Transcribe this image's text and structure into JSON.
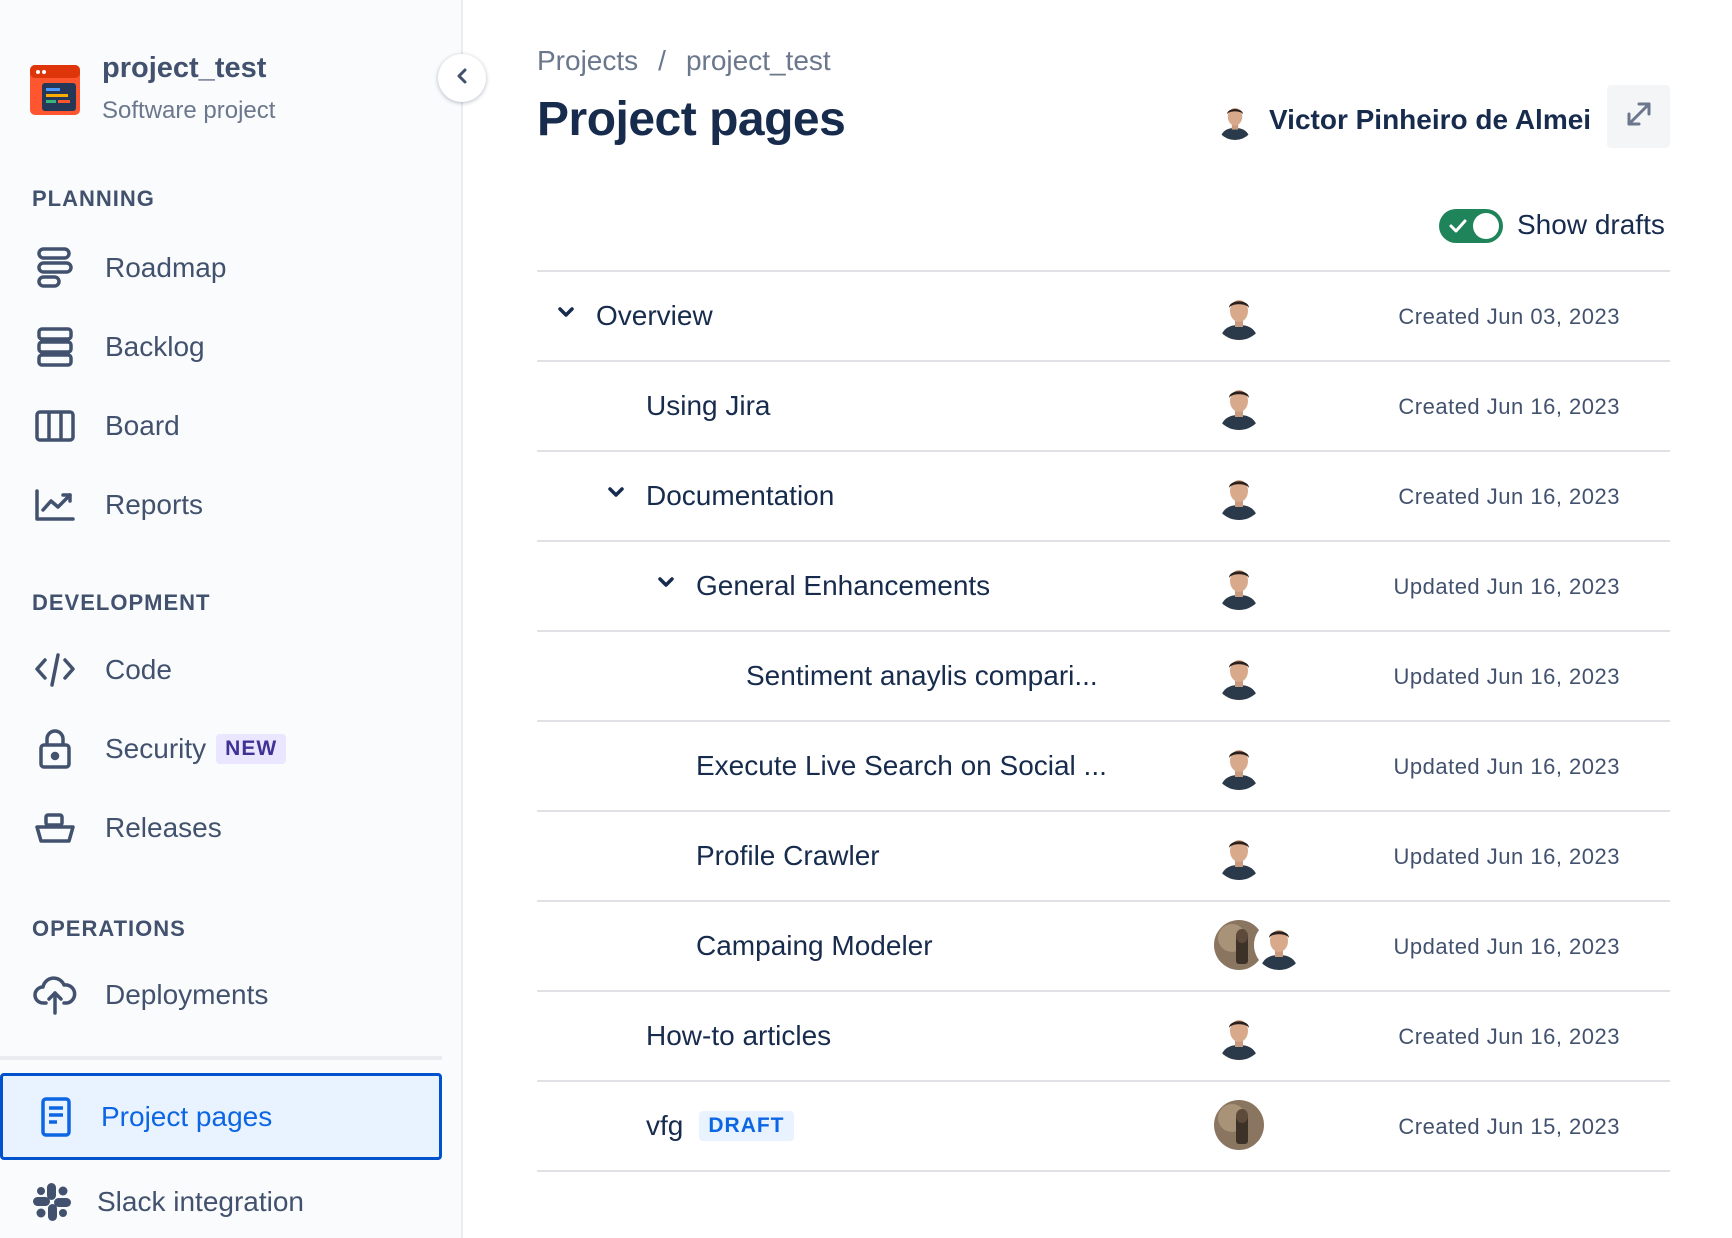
{
  "sidebar": {
    "project_name": "project_test",
    "project_type": "Software project",
    "sections": {
      "planning": "PLANNING",
      "development": "DEVELOPMENT",
      "operations": "OPERATIONS"
    },
    "items": {
      "roadmap": "Roadmap",
      "backlog": "Backlog",
      "board": "Board",
      "reports": "Reports",
      "code": "Code",
      "security": "Security",
      "security_badge": "NEW",
      "releases": "Releases",
      "deployments": "Deployments",
      "project_pages": "Project pages",
      "slack": "Slack integration"
    }
  },
  "header": {
    "breadcrumb_root": "Projects",
    "breadcrumb_sep": "/",
    "breadcrumb_current": "project_test",
    "title": "Project pages",
    "owner": "Victor Pinheiro de Almeida",
    "show_drafts_label": "Show drafts",
    "show_drafts_on": true
  },
  "pages": [
    {
      "title": "Overview",
      "depth": 0,
      "expanded": true,
      "avatars": [
        "man"
      ],
      "date": "Created Jun 03, 2023"
    },
    {
      "title": "Using Jira",
      "depth": 1,
      "avatars": [
        "man"
      ],
      "date": "Created Jun 16, 2023"
    },
    {
      "title": "Documentation",
      "depth": 1,
      "expanded": true,
      "avatars": [
        "man"
      ],
      "date": "Created Jun 16, 2023"
    },
    {
      "title": "General Enhancements",
      "depth": 2,
      "expanded": true,
      "avatars": [
        "man"
      ],
      "date": "Updated Jun 16, 2023"
    },
    {
      "title": "Sentiment anaylis compari...",
      "depth": 3,
      "avatars": [
        "man"
      ],
      "date": "Updated Jun 16, 2023"
    },
    {
      "title": "Execute Live Search on Social ...",
      "depth": 2,
      "avatars": [
        "man"
      ],
      "date": "Updated Jun 16, 2023"
    },
    {
      "title": "Profile Crawler",
      "depth": 2,
      "avatars": [
        "man"
      ],
      "date": "Updated Jun 16, 2023"
    },
    {
      "title": "Campaing Modeler",
      "depth": 2,
      "avatars": [
        "photo",
        "man"
      ],
      "date": "Updated Jun 16, 2023"
    },
    {
      "title": "How-to articles",
      "depth": 1,
      "avatars": [
        "man"
      ],
      "date": "Created Jun 16, 2023"
    },
    {
      "title": "vfg",
      "depth": 1,
      "badge": "DRAFT",
      "avatars": [
        "photo"
      ],
      "date": "Created Jun 15, 2023"
    }
  ],
  "colors": {
    "accent": "#0052cc",
    "toggle_on": "#1f845a",
    "text_primary": "#172b4d",
    "text_secondary": "#42526e"
  }
}
